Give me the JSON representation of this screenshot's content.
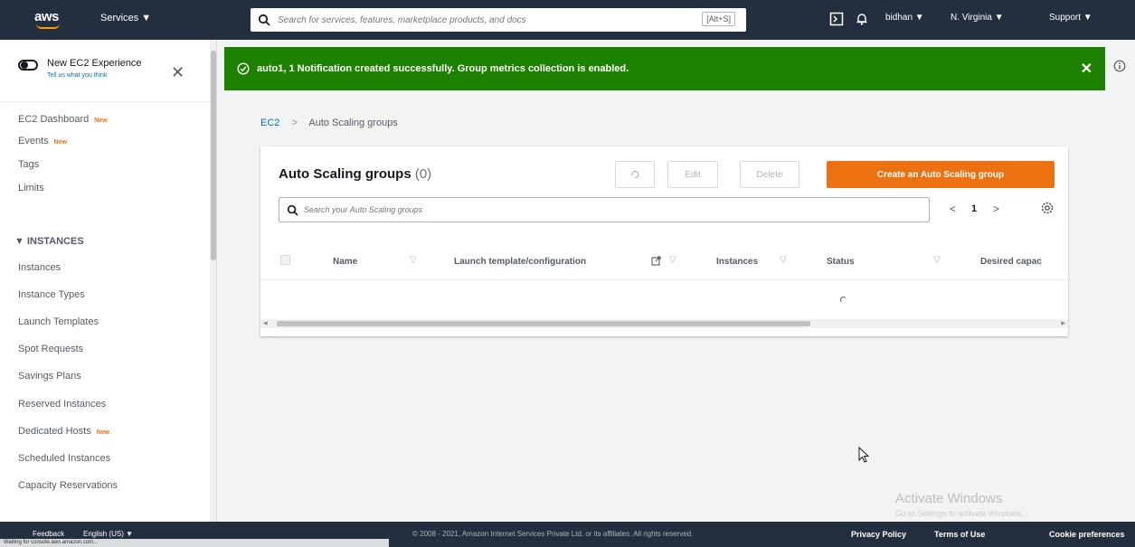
{
  "header": {
    "logo_text": "aws",
    "services_label": "Services ▼",
    "search_placeholder": "Search for services, features, marketplace products, and docs",
    "search_shortcut": "[Alt+S]",
    "user_label": "bidhan ▼",
    "region_label": "N. Virginia ▼",
    "support_label": "Support ▼"
  },
  "sidebar": {
    "toggle_title": "New EC2 Experience",
    "toggle_subtitle": "Tell us what you think",
    "items_top": [
      {
        "label": "EC2 Dashboard",
        "badge": "New"
      },
      {
        "label": "Events",
        "badge": "New"
      },
      {
        "label": "Tags",
        "badge": ""
      },
      {
        "label": "Limits",
        "badge": ""
      }
    ],
    "section_title": "▼ INSTANCES",
    "items_instances": [
      {
        "label": "Instances",
        "badge": ""
      },
      {
        "label": "Instance Types",
        "badge": ""
      },
      {
        "label": "Launch Templates",
        "badge": ""
      },
      {
        "label": "Spot Requests",
        "badge": ""
      },
      {
        "label": "Savings Plans",
        "badge": ""
      },
      {
        "label": "Reserved Instances",
        "badge": ""
      },
      {
        "label": "Dedicated Hosts",
        "badge": "New"
      },
      {
        "label": "Scheduled Instances",
        "badge": ""
      },
      {
        "label": "Capacity Reservations",
        "badge": ""
      }
    ]
  },
  "flash": {
    "message": "auto1, 1 Notification created successfully. Group metrics collection is enabled.",
    "color": "#1d8102"
  },
  "breadcrumb": {
    "root": "EC2",
    "separator": ">",
    "current": "Auto Scaling groups"
  },
  "panel": {
    "title": "Auto Scaling groups",
    "count": "(0)",
    "edit_label": "Edit",
    "delete_label": "Delete",
    "create_label": "Create an Auto Scaling group",
    "filter_placeholder": "Search your Auto Scaling groups",
    "page_prev": "<",
    "page_number": "1",
    "page_next": ">",
    "columns": [
      "Name",
      "Launch template/configuration",
      "Instances",
      "Status",
      "Desired capac"
    ],
    "accent_color": "#ec7211"
  },
  "watermark": {
    "line1": "Activate Windows",
    "line2": "Go to Settings to activate Windows."
  },
  "footer": {
    "feedback": "Feedback",
    "language": "English (US) ▼",
    "copyright": "© 2008 - 2021, Amazon Internet Services Private Ltd. or its affiliates. All rights reserved.",
    "privacy": "Privacy Policy",
    "terms": "Terms of Use",
    "cookies": "Cookie preferences",
    "status_url": "Waiting for console.aws.amazon.com..."
  }
}
